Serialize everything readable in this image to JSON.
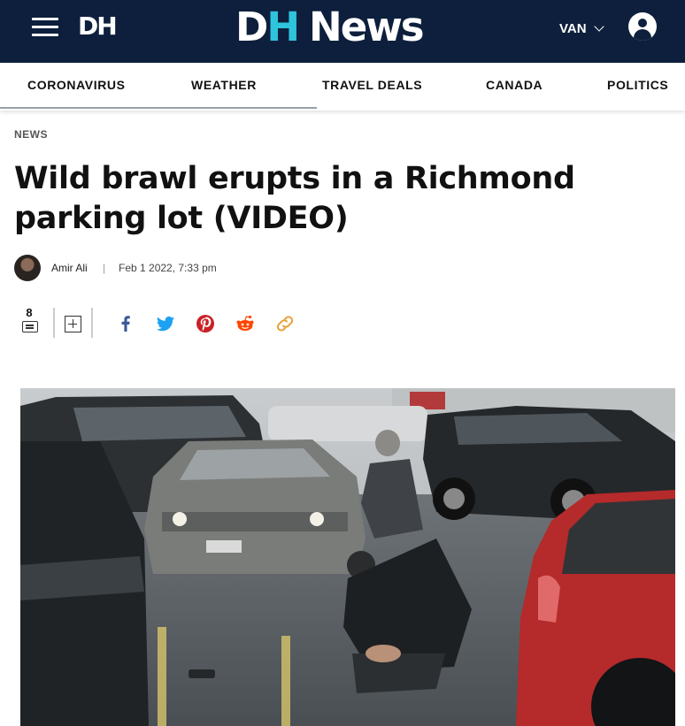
{
  "header": {
    "section_logo": "DH",
    "brand": {
      "d": "D",
      "h": "H",
      "news": "News"
    },
    "region": "VAN",
    "icons": [
      "hamburger-menu-icon",
      "chevron-down-icon",
      "user-account-icon"
    ],
    "colors": {
      "header_bg": "#0d1f3c",
      "brand_accent": "#2ec4dc"
    }
  },
  "nav": {
    "items": [
      {
        "label": "CORONAVIRUS"
      },
      {
        "label": "WEATHER"
      },
      {
        "label": "TRAVEL DEALS"
      },
      {
        "label": "CANADA"
      },
      {
        "label": "POLITICS"
      }
    ]
  },
  "article": {
    "kicker": "NEWS",
    "headline": "Wild brawl erupts in a Richmond parking lot (VIDEO)",
    "author": "Amir Ali",
    "separator": "|",
    "date": "Feb 1 2022, 7:33 pm",
    "comment_count": "8",
    "share_icons": [
      "facebook-icon",
      "twitter-icon",
      "pinterest-icon",
      "reddit-icon",
      "link-icon"
    ],
    "share_colors": {
      "facebook": "#3b5998",
      "twitter": "#1da1f2",
      "pinterest": "#cb2027",
      "reddit": "#ff4500",
      "link": "#e8a13a"
    }
  }
}
